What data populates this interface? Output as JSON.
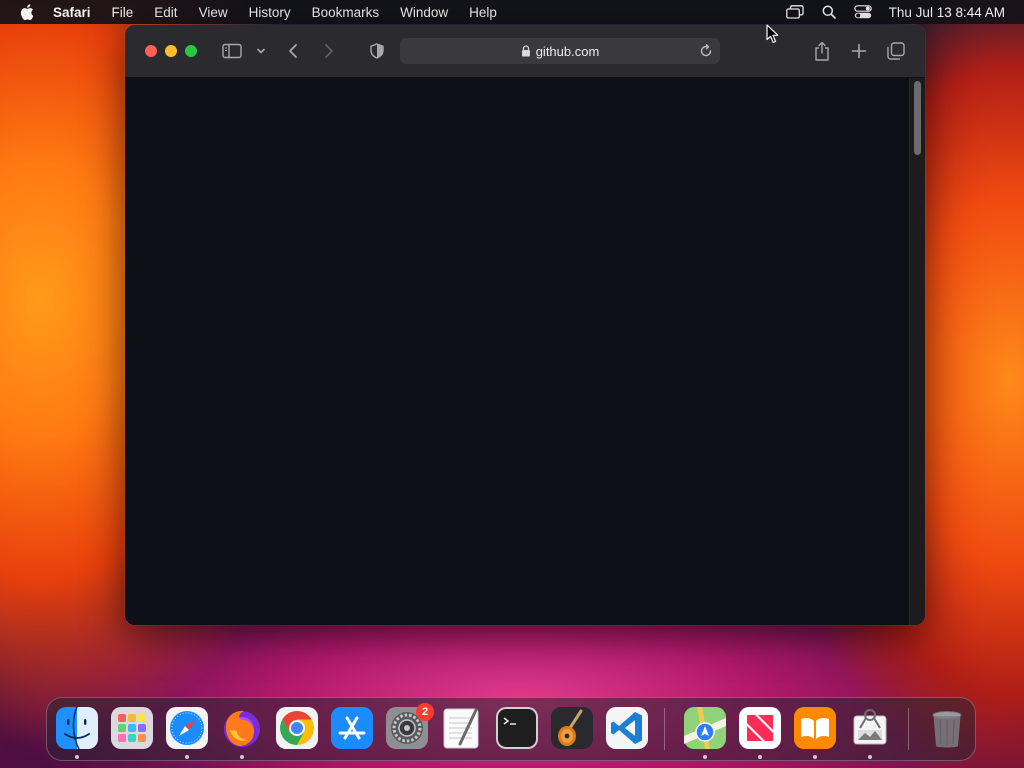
{
  "menubar": {
    "app_name": "Safari",
    "items": [
      "File",
      "Edit",
      "View",
      "History",
      "Bookmarks",
      "Window",
      "Help"
    ],
    "clock": "Thu Jul 13  8:44 AM"
  },
  "browser": {
    "url": "github.com"
  },
  "dock": {
    "apps": [
      {
        "name": "finder-icon"
      },
      {
        "name": "launchpad-icon"
      },
      {
        "name": "safari-icon"
      },
      {
        "name": "firefox-icon"
      },
      {
        "name": "chrome-icon"
      },
      {
        "name": "app-store-icon"
      },
      {
        "name": "system-settings-icon"
      },
      {
        "name": "textedit-icon"
      },
      {
        "name": "terminal-icon"
      },
      {
        "name": "garageband-icon"
      },
      {
        "name": "vscode-icon"
      },
      {
        "name": "maps-icon"
      },
      {
        "name": "news-icon"
      },
      {
        "name": "books-icon"
      },
      {
        "name": "preview-icon"
      },
      {
        "name": "trash-icon"
      }
    ],
    "system_settings_badge": "2"
  },
  "colors": {
    "page_background": "#0d1117",
    "toolbar": "#2b2a2f",
    "close": "#ff5f57",
    "minimize": "#febc2e",
    "maximize": "#28c840"
  }
}
